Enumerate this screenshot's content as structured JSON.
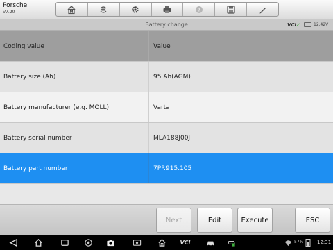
{
  "vehicle": {
    "name": "Porsche",
    "version": "V7.20"
  },
  "toolbar": {
    "buttons": [
      {
        "icon": "home-m-icon"
      },
      {
        "icon": "vehicle-swap-icon"
      },
      {
        "icon": "gear-icon"
      },
      {
        "icon": "printer-icon"
      },
      {
        "icon": "help-icon"
      },
      {
        "icon": "save-icon"
      },
      {
        "icon": "pen-icon"
      }
    ]
  },
  "title_strip": {
    "title": "Battery change",
    "vci_label": "VCI",
    "voltage": "12.42V"
  },
  "table": {
    "header": {
      "col1": "Coding value",
      "col2": "Value"
    },
    "rows": [
      {
        "label": "Battery size (Ah)",
        "value": "95 Ah(AGM)"
      },
      {
        "label": "Battery manufacturer (e.g. MOLL)",
        "value": "Varta"
      },
      {
        "label": "Battery serial number",
        "value": "MLA188J00J"
      },
      {
        "label": "Battery part number",
        "value": "7PP.915.105",
        "selected": true
      }
    ]
  },
  "actions": {
    "next": "Next",
    "edit": "Edit",
    "execute": "Execute",
    "esc": "ESC"
  },
  "system_bar": {
    "vci_label": "VCI",
    "battery_level": "57%",
    "time": "12:31"
  },
  "colors": {
    "selected_row": "#1e8ff2",
    "header_row": "#9e9e9e",
    "vci_check": "#3fae3f"
  }
}
